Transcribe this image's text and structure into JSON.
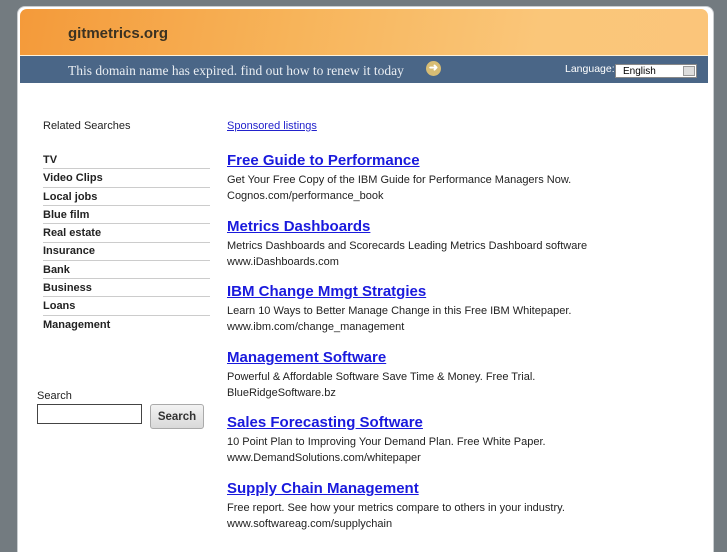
{
  "header": {
    "site": "gitmetrics.org",
    "expired_text": "This domain name has expired. find out how to renew it today",
    "language_label": "Language:",
    "language_value": "English"
  },
  "sidebar": {
    "title": "Related Searches",
    "items": [
      "TV",
      "Video Clips",
      "Local jobs",
      "Blue film",
      "Real estate",
      "Insurance",
      "Bank",
      "Business",
      "Loans",
      "Management"
    ],
    "search_label": "Search",
    "search_button": "Search",
    "search_value": ""
  },
  "main": {
    "sponsored": "Sponsored listings",
    "ads": [
      {
        "title": "Free Guide to Performance",
        "desc": "Get Your Free Copy of the IBM Guide for Performance Managers Now.",
        "url": "Cognos.com/performance_book"
      },
      {
        "title": "Metrics Dashboards",
        "desc": "Metrics Dashboards and Scorecards Leading Metrics Dashboard software",
        "url": "www.iDashboards.com"
      },
      {
        "title": "IBM Change Mmgt Stratgies",
        "desc": "Learn 10 Ways to Better Manage Change in this Free IBM Whitepaper.",
        "url": "www.ibm.com/change_management"
      },
      {
        "title": "Management Software",
        "desc": "Powerful & Affordable Software Save Time & Money. Free Trial.",
        "url": "BlueRidgeSoftware.bz"
      },
      {
        "title": "Sales Forecasting Software",
        "desc": "10 Point Plan to Improving Your Demand Plan. Free White Paper.",
        "url": "www.DemandSolutions.com/whitepaper"
      },
      {
        "title": "Supply Chain Management",
        "desc": "Free report. See how your metrics compare to others in your industry.",
        "url": "www.softwareag.com/supplychain"
      }
    ]
  }
}
